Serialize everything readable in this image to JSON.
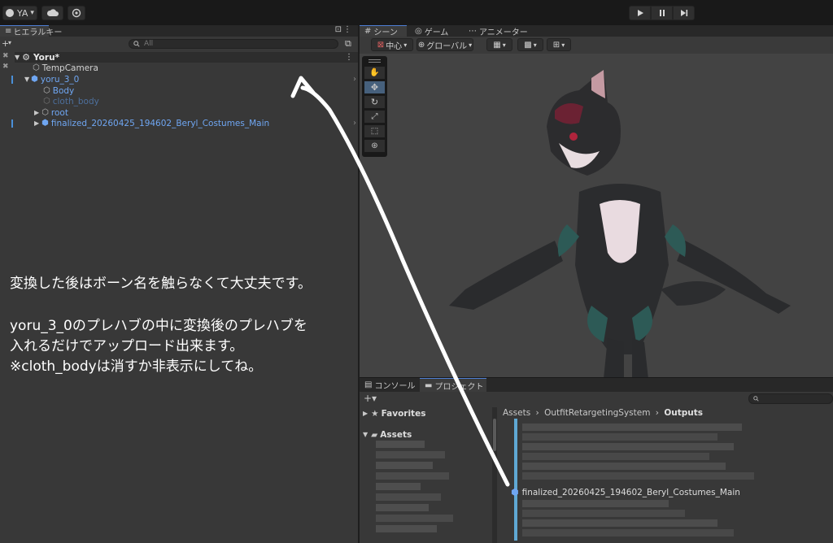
{
  "toolbar": {
    "account_label": "YA",
    "account_caret": "▾",
    "cloud_icon": "cloud-icon",
    "services_icon": "gear-icon",
    "play_icon": "play-icon",
    "pause_icon": "pause-icon",
    "step_icon": "step-icon"
  },
  "hierarchy": {
    "tab_label": "ヒエラルキー",
    "add_label": "+",
    "search_placeholder": "All",
    "items": [
      {
        "label": "Yoru*"
      },
      {
        "label": "TempCamera"
      },
      {
        "label": "yoru_3_0"
      },
      {
        "label": "Body"
      },
      {
        "label": "cloth_body"
      },
      {
        "label": "root"
      },
      {
        "label": "finalized_20260425_194602_Beryl_Costumes_Main"
      }
    ]
  },
  "scene_view": {
    "tabs": [
      {
        "label": "シーン"
      },
      {
        "label": "ゲーム"
      },
      {
        "label": "アニメーター"
      }
    ],
    "pivot_label": "中心",
    "space_label": "グローバル",
    "tools": [
      "menu",
      "hand-icon",
      "move-icon",
      "rotate-icon",
      "scale-icon",
      "rect-icon",
      "transform-icon"
    ]
  },
  "project": {
    "tabs": [
      {
        "label": "コンソール"
      },
      {
        "label": "プロジェクト"
      }
    ],
    "add_label": "+▾",
    "favorites_label": "Favorites",
    "assets_label": "Assets",
    "breadcrumb": [
      "Assets",
      "OutfitRetargetingSystem",
      "Outputs"
    ],
    "highlighted_file": "finalized_20260425_194602_Beryl_Costumes_Main"
  },
  "annotation": {
    "line1": "変換した後はボーン名を触らなくて大丈夫です。",
    "line2": "yoru_3_0のプレハブの中に変換後のプレハブを",
    "line3": "入れるだけでアップロード出来ます。",
    "line4": "※cloth_bodyは消すか非表示にしてね。"
  }
}
